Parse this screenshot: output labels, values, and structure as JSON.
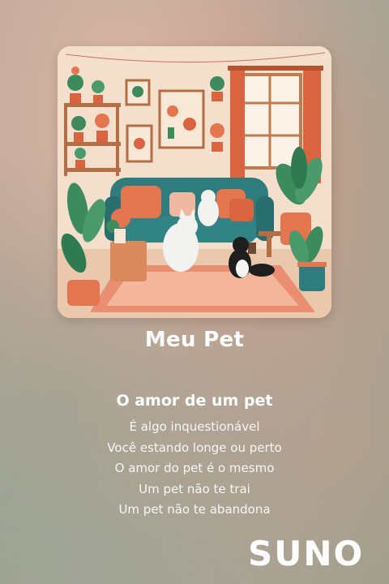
{
  "song": {
    "title": "Meu Pet",
    "cover_image": "living-room-cats-illustration"
  },
  "lyrics": {
    "heading": "O amor de um pet",
    "lines": [
      "É algo inquestionável",
      "Você estando longe ou perto",
      "O amor do pet é o mesmo",
      "Um pet não te trai",
      "Um pet não te abandona"
    ]
  },
  "brand": {
    "logo_text": "SUNO"
  },
  "colors": {
    "text": "#ffffff",
    "sofa": "#2f7c7d",
    "cushion": "#e3764f",
    "wall": "#f2ddca",
    "curtain": "#d9643f"
  }
}
